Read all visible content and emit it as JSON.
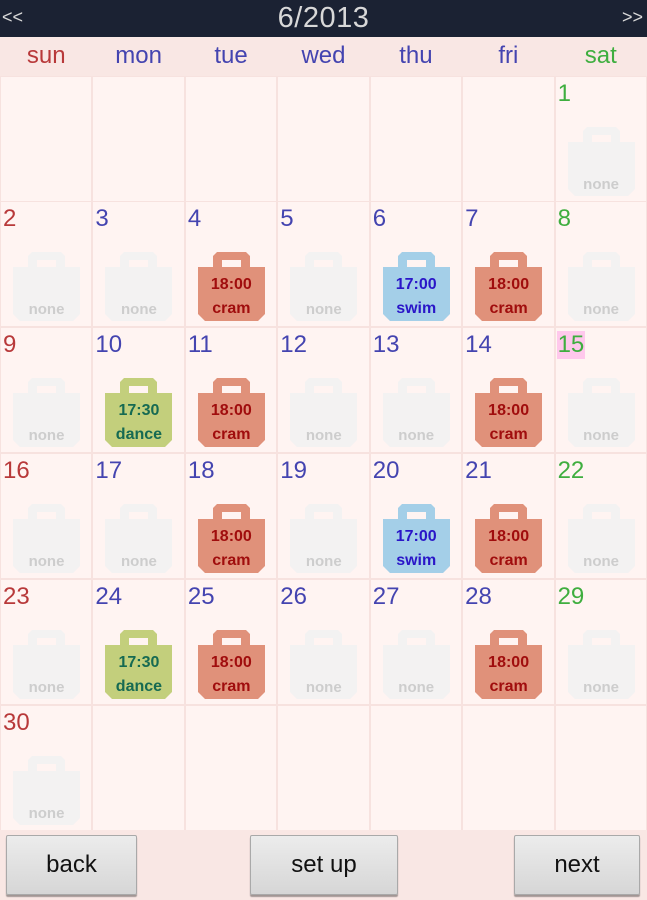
{
  "header": {
    "title": "6/2013",
    "prev_label": "<<",
    "next_label": ">>"
  },
  "weekdays": [
    {
      "label": "sun",
      "color": "#b8393a"
    },
    {
      "label": "mon",
      "color": "#4444b0"
    },
    {
      "label": "tue",
      "color": "#4444b0"
    },
    {
      "label": "wed",
      "color": "#4444b0"
    },
    {
      "label": "thu",
      "color": "#4444b0"
    },
    {
      "label": "fri",
      "color": "#4444b0"
    },
    {
      "label": "sat",
      "color": "#3fae3f"
    }
  ],
  "calendar": {
    "month": 6,
    "year": 2013,
    "first_weekday": 6,
    "days_in_month": 30,
    "today": 15,
    "none_label": "none",
    "event_types": {
      "cram": {
        "time": "18:00",
        "name": "cram",
        "bag_color": "#e0917a",
        "text_color": "#a00d0d"
      },
      "swim": {
        "time": "17:00",
        "name": "swim",
        "bag_color": "#a4cfe8",
        "text_color": "#2a16c8"
      },
      "dance": {
        "time": "17:30",
        "name": "dance",
        "bag_color": "#c3cf7c",
        "text_color": "#166a52"
      }
    },
    "events": {
      "4": "cram",
      "6": "swim",
      "7": "cram",
      "10": "dance",
      "11": "cram",
      "14": "cram",
      "18": "cram",
      "20": "swim",
      "21": "cram",
      "24": "dance",
      "25": "cram",
      "28": "cram"
    }
  },
  "buttons": {
    "back": "back",
    "setup": "set up",
    "next": "next"
  }
}
